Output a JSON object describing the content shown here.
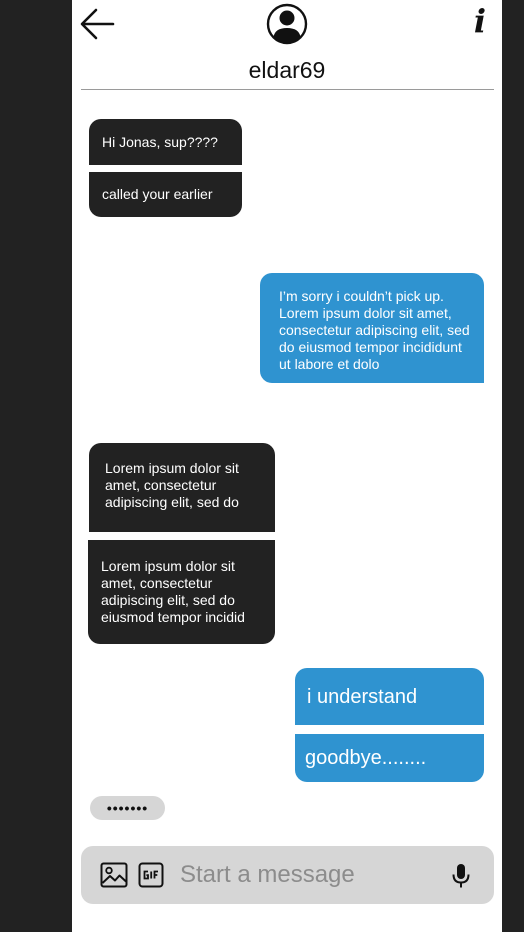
{
  "header": {
    "back_icon": "arrow-left-icon",
    "avatar_icon": "user-circle-icon",
    "info_label": "i",
    "username": "eldar69"
  },
  "messages": [
    {
      "direction": "incoming",
      "text": "Hi Jonas, sup????"
    },
    {
      "direction": "incoming",
      "text": "called your earlier"
    },
    {
      "direction": "outgoing",
      "text": "I’m sorry i couldn’t pick up. Lorem ipsum dolor sit amet, consectetur adipiscing elit, sed do eiusmod tempor incididunt ut labore et dolo"
    },
    {
      "direction": "incoming",
      "text": "Lorem ipsum dolor sit amet, consectetur adipiscing elit, sed do"
    },
    {
      "direction": "incoming",
      "text": "Lorem ipsum dolor sit amet, consectetur adipiscing elit, sed do eiusmod tempor incidid"
    },
    {
      "direction": "outgoing",
      "text": "i understand"
    },
    {
      "direction": "outgoing",
      "text": "goodbye........"
    }
  ],
  "typing_indicator": "•••••••",
  "composer": {
    "placeholder": "Start a message",
    "value": "",
    "image_icon": "image-icon",
    "gif_icon": "gif-icon",
    "mic_icon": "microphone-icon"
  },
  "colors": {
    "incoming_bubble": "#222222",
    "outgoing_bubble": "#2f93d0",
    "composer_bg": "#d6d6d6",
    "outer_bg": "#222222"
  }
}
